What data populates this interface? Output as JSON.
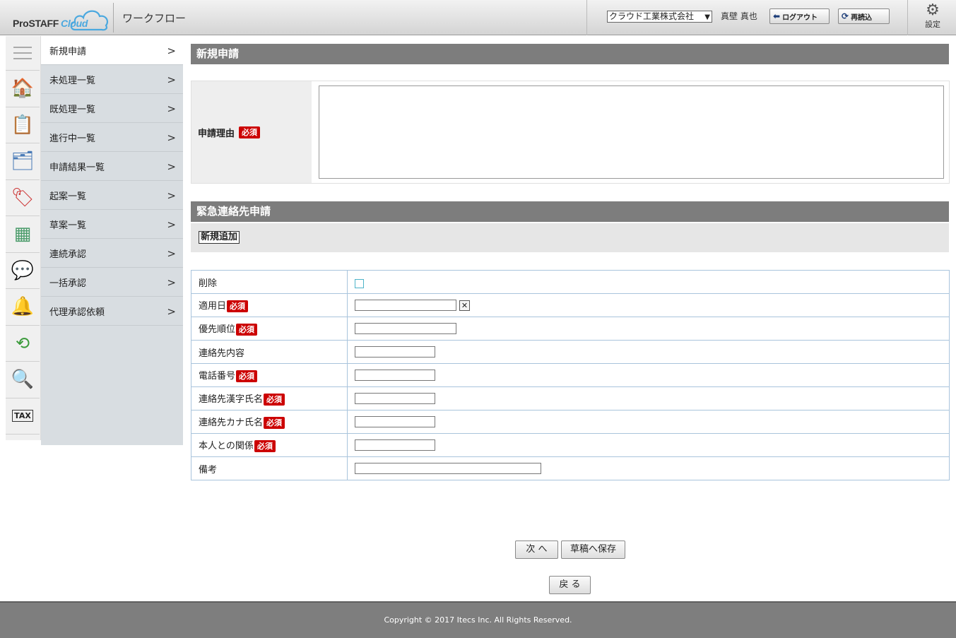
{
  "header": {
    "logo_text": "ProSTAFF",
    "logo_cloud": "Cloud",
    "app_title": "ワークフロー",
    "company_selected": "クラウド工業株式会社",
    "user_name": "真壁 真也",
    "logout_label": "ログアウト",
    "reload_label": "再読込",
    "settings_label": "設定"
  },
  "iconbar": {
    "icons": [
      "menu-icon",
      "home-icon",
      "document-icon",
      "timecard-icon",
      "stamp-icon",
      "spreadsheet-icon",
      "chat-icon",
      "bell-icon",
      "history-icon",
      "search-icon",
      "tax-icon"
    ],
    "tax_label": "TAX"
  },
  "menu": {
    "items": [
      {
        "label": "新規申請"
      },
      {
        "label": "未処理一覧"
      },
      {
        "label": "既処理一覧"
      },
      {
        "label": "進行中一覧"
      },
      {
        "label": "申請結果一覧"
      },
      {
        "label": "起案一覧"
      },
      {
        "label": "草案一覧"
      },
      {
        "label": "連続承認"
      },
      {
        "label": "一括承認"
      },
      {
        "label": "代理承認依頼"
      }
    ]
  },
  "main": {
    "section1_title": "新規申請",
    "reason_label": "申請理由",
    "required_badge": "必須",
    "reason_value": "",
    "section2_title": "緊急連絡先申請",
    "add_button": "新規追加",
    "rows": [
      {
        "label": "削除"
      },
      {
        "label": "適用日"
      },
      {
        "label": "優先順位"
      },
      {
        "label": "連絡先内容"
      },
      {
        "label": "電話番号"
      },
      {
        "label": "連絡先漢字氏名"
      },
      {
        "label": "連絡先カナ氏名"
      },
      {
        "label": "本人との関係"
      },
      {
        "label": "備考"
      }
    ],
    "next_button": "次 へ",
    "draft_button": "草稿へ保存",
    "back_button": "戻 る"
  },
  "footer": {
    "copyright": "Copyright © 2017 Itecs Inc. All Rights Reserved."
  }
}
